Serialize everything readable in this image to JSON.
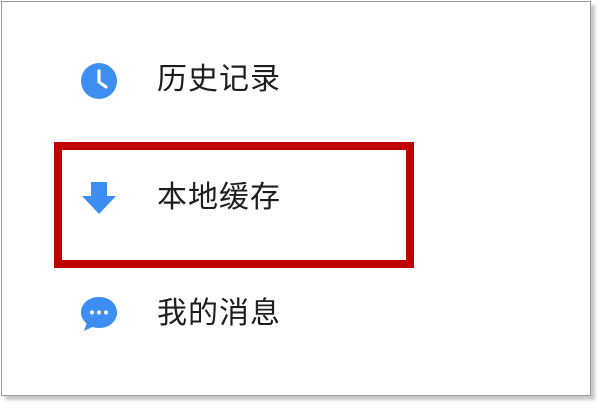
{
  "menu": {
    "items": [
      {
        "label": "历史记录",
        "icon": "clock-icon"
      },
      {
        "label": "本地缓存",
        "icon": "download-arrow-icon"
      },
      {
        "label": "我的消息",
        "icon": "chat-bubble-icon"
      }
    ]
  },
  "colors": {
    "icon_blue": "#3d8ef2",
    "highlight_red": "#c00000",
    "text": "#1e1e1e"
  }
}
